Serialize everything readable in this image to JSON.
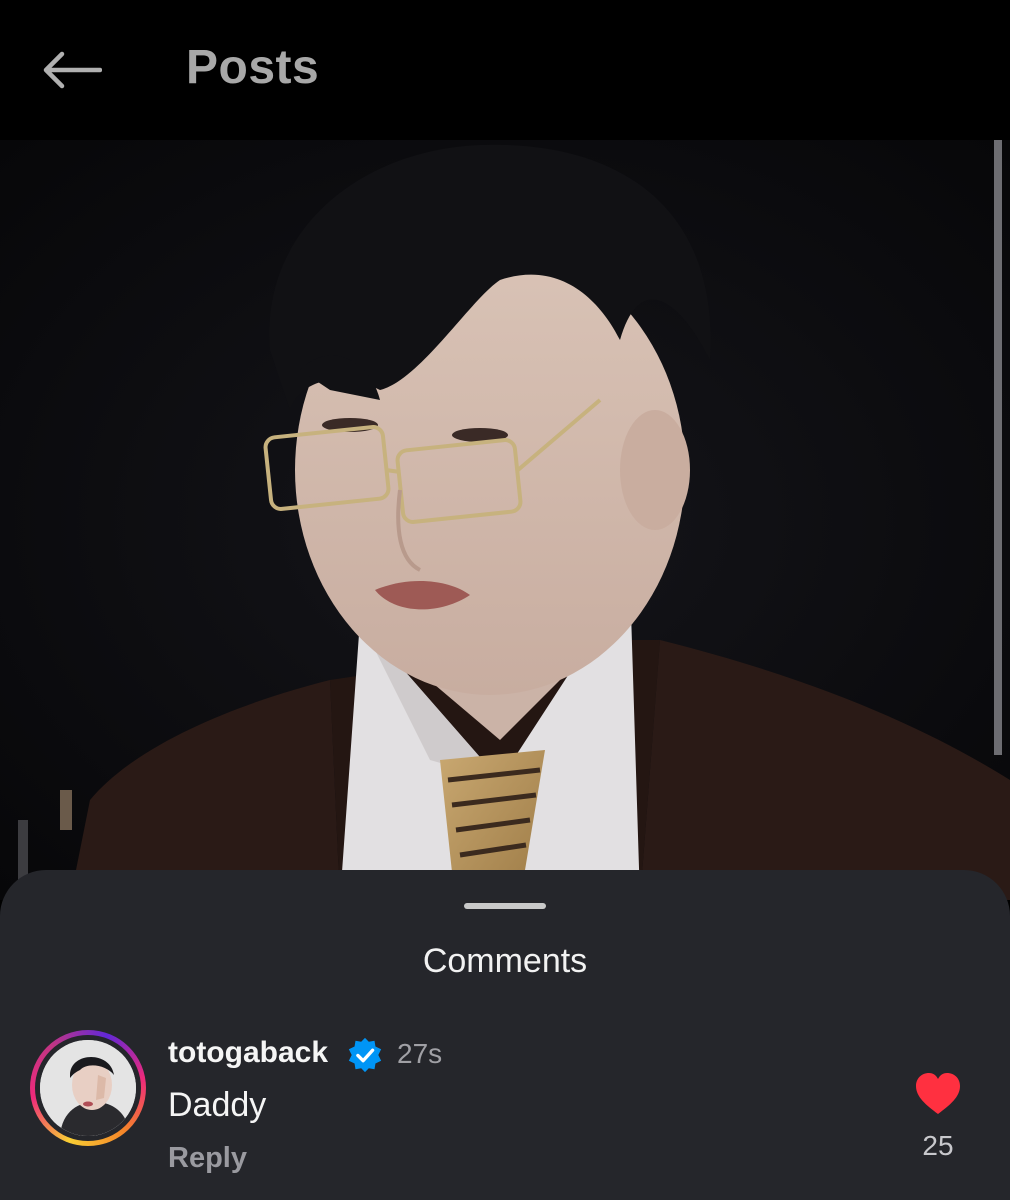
{
  "header": {
    "back_icon": "arrow-left-icon",
    "title": "Posts"
  },
  "post": {
    "media_type": "photo"
  },
  "comments_sheet": {
    "title": "Comments",
    "comments": [
      {
        "username": "totogaback",
        "verified": true,
        "time": "27s",
        "text": "Daddy",
        "reply_label": "Reply",
        "likes": "25",
        "liked": true
      }
    ]
  },
  "colors": {
    "background": "#000000",
    "sheet": "#25262b",
    "like": "#ff3040",
    "verified": "#0095f6"
  }
}
